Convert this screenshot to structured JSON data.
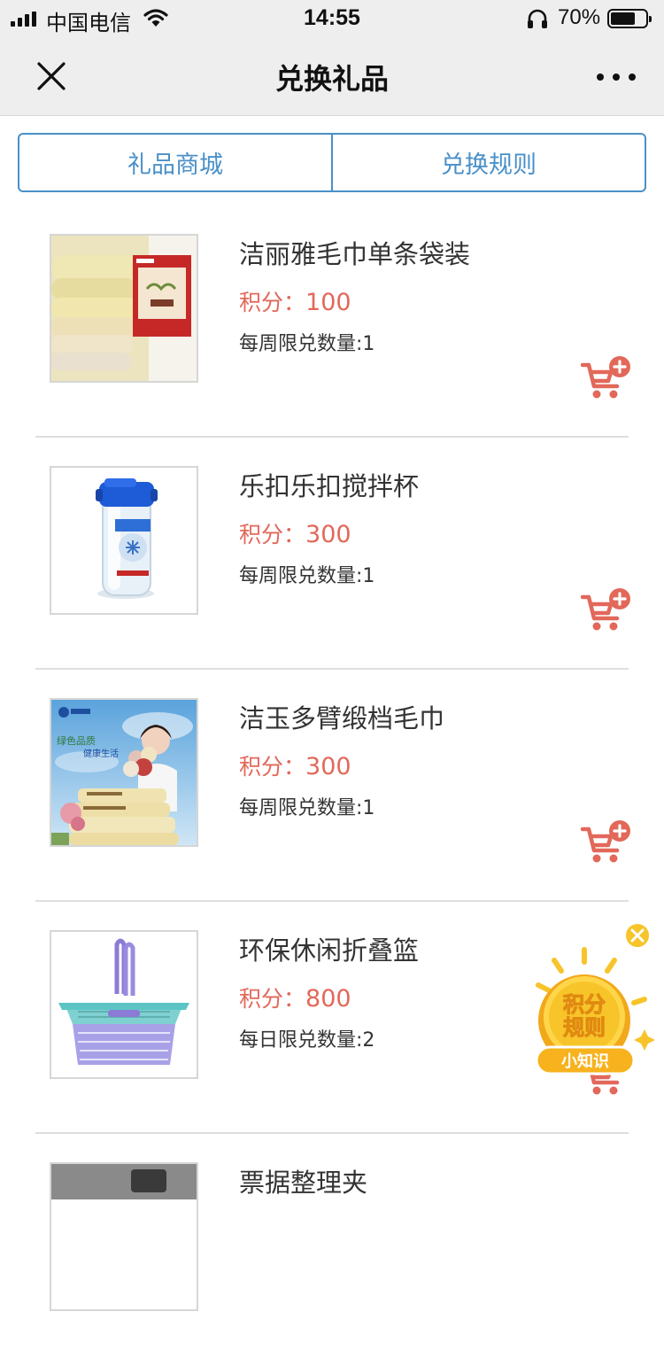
{
  "status_bar": {
    "carrier": "中国电信",
    "time": "14:55",
    "battery_percent": "70%",
    "battery_level": 0.7,
    "icons": [
      "signal-icon",
      "wifi-icon",
      "headphone-icon",
      "battery-icon"
    ]
  },
  "nav": {
    "title": "兑换礼品",
    "close_icon": "close-icon",
    "more_icon": "more-icon"
  },
  "tabs": [
    {
      "label": "礼品商城"
    },
    {
      "label": "兑换规则"
    }
  ],
  "items": [
    {
      "name": "洁丽雅毛巾单条袋装",
      "points_label": "积分：",
      "points": "100",
      "limit": "每周限兑数量:1",
      "image": "towel-bag-image"
    },
    {
      "name": "乐扣乐扣搅拌杯",
      "points_label": "积分：",
      "points": "300",
      "limit": "每周限兑数量:1",
      "image": "shaker-cup-image"
    },
    {
      "name": "洁玉多臂缎档毛巾",
      "points_label": "积分：",
      "points": "300",
      "limit": "每周限兑数量:1",
      "image": "towel-ad-image"
    },
    {
      "name": "环保休闲折叠篮",
      "points_label": "积分：",
      "points": "800",
      "limit": "每日限兑数量:2",
      "image": "folding-basket-image"
    },
    {
      "name": "票据整理夹",
      "image": "folder-image"
    }
  ],
  "ad_image_text": [
    "绿色品质",
    "健康生活"
  ],
  "float_badge": {
    "line1": "积分",
    "line2": "规则",
    "ribbon": "小知识"
  },
  "colors": {
    "accent_blue": "#4a90c8",
    "points_red": "#e2685a",
    "badge_yellow": "#f7c42a"
  }
}
